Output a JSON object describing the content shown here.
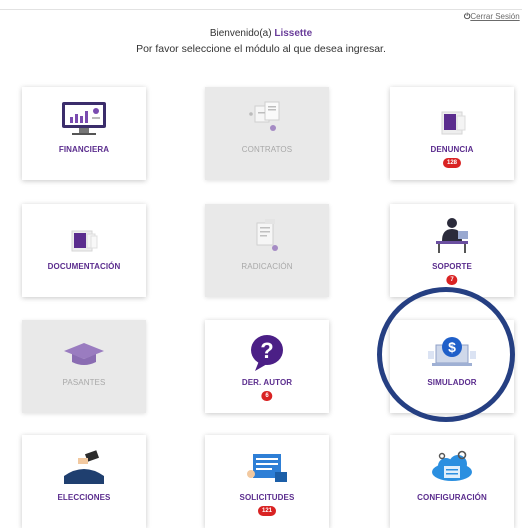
{
  "header": {
    "logout_label": "Cerrar Sesión",
    "welcome_prefix": "Bienvenido(a)",
    "user_name": "Lissette",
    "instructions": "Por favor seleccione el módulo al que desea ingresar."
  },
  "modules": [
    {
      "label": "FINANCIERA",
      "icon": "monitor-chart-icon",
      "enabled": true,
      "badge": ""
    },
    {
      "label": "CONTRATOS",
      "icon": "contract-docs-icon",
      "enabled": false,
      "badge": ""
    },
    {
      "label": "DENUNCIA",
      "icon": "complaint-doc-icon",
      "enabled": true,
      "badge": "128"
    },
    {
      "label": "DOCUMENTACIÓN",
      "icon": "documents-icon",
      "enabled": true,
      "badge": ""
    },
    {
      "label": "RADICACIÓN",
      "icon": "filing-icon",
      "enabled": false,
      "badge": ""
    },
    {
      "label": "SOPORTE",
      "icon": "support-agent-icon",
      "enabled": true,
      "badge": "7"
    },
    {
      "label": "PASANTES",
      "icon": "graduation-cap-icon",
      "enabled": false,
      "badge": ""
    },
    {
      "label": "DER. AUTOR",
      "icon": "question-bubble-icon",
      "enabled": true,
      "badge": "6"
    },
    {
      "label": "SIMULADOR",
      "icon": "dollar-laptop-icon",
      "enabled": true,
      "badge": ""
    },
    {
      "label": "ELECCIONES",
      "icon": "ballot-box-icon",
      "enabled": true,
      "badge": ""
    },
    {
      "label": "SOLICITUDES",
      "icon": "requests-icon",
      "enabled": true,
      "badge": "121"
    },
    {
      "label": "CONFIGURACIÓN",
      "icon": "cloud-settings-icon",
      "enabled": true,
      "badge": ""
    }
  ],
  "colors": {
    "accent": "#5b2d8e",
    "badge": "#d92323",
    "highlight_circle": "#253f82"
  }
}
